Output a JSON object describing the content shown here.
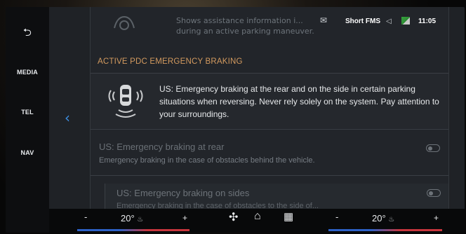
{
  "rail": {
    "back_icon": "back-arrow-icon",
    "back_glyph": "⮌",
    "media": "MEDIA",
    "tel": "TEL",
    "nav": "NAV"
  },
  "status": {
    "message_glyph": "✉",
    "source": "Short FMS",
    "volume_glyph": "◁",
    "time": "11:05"
  },
  "faded_row": {
    "text": "Shows assistance information i... during an active parking maneuver."
  },
  "section": {
    "header": "ACTIVE PDC EMERGENCY BRAKING"
  },
  "info_card": {
    "text": "US: Emergency braking at the rear and on the side in certain parking situations when reversing. Never rely solely on the system. Pay attention to your surroundings."
  },
  "option_rear": {
    "title": "US: Emergency braking at rear",
    "desc": "Emergency braking in the case of obstacles behind the vehicle."
  },
  "option_sides": {
    "title": "US: Emergency braking on sides",
    "desc": "Emergency braking in the case of obstacles to the side of..."
  },
  "climate": {
    "minus_left": "-",
    "temp_left": "20°",
    "plus_left": "+",
    "minus_right": "-",
    "temp_right": "20°",
    "plus_right": "+",
    "fan_glyph": "✣",
    "home_glyph": "⌂",
    "apps_glyph": "▦"
  },
  "colors": {
    "accent": "#3d8fe0",
    "section_header": "#d39a5f",
    "climate_cold": "#2d62c8",
    "climate_hot": "#c9363d"
  }
}
